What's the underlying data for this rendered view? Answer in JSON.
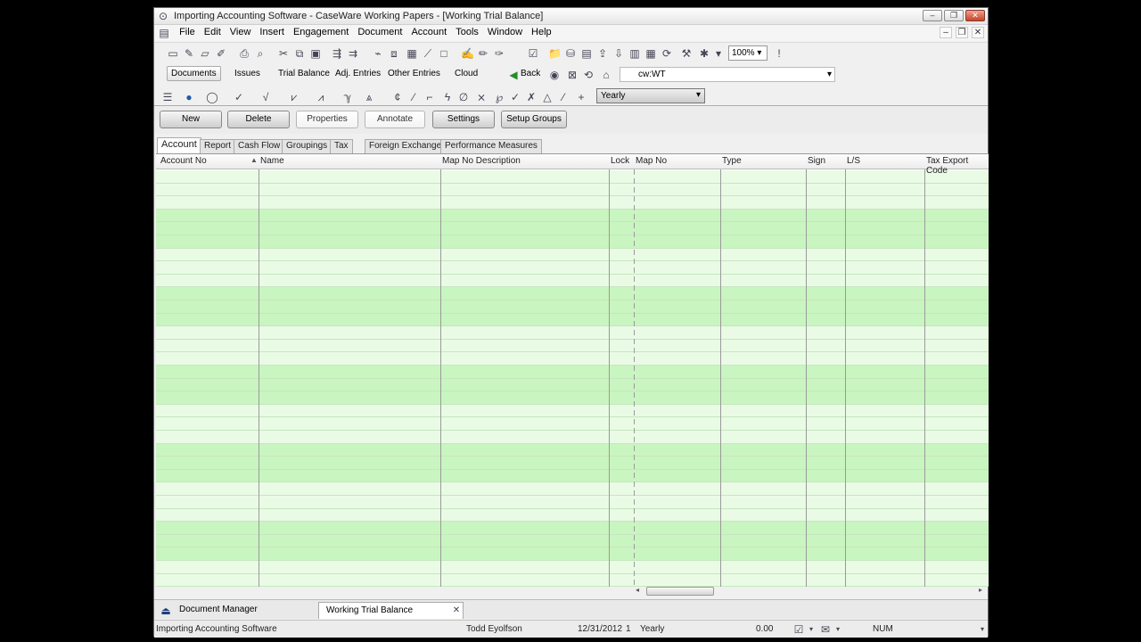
{
  "window": {
    "title": "Importing Accounting Software - CaseWare Working Papers - [Working Trial Balance]"
  },
  "menu": [
    "File",
    "Edit",
    "View",
    "Insert",
    "Engagement",
    "Document",
    "Account",
    "Tools",
    "Window",
    "Help"
  ],
  "toolbar": {
    "zoom": "100%"
  },
  "nav": {
    "items": [
      "Documents",
      "Issues",
      "Trial Balance",
      "Adj. Entries",
      "Other Entries",
      "Cloud"
    ],
    "back_label": "Back",
    "address": "cw:WT"
  },
  "period_select": "Yearly",
  "commands": [
    "New",
    "Delete",
    "Properties",
    "Annotate",
    "Settings",
    "Setup Groups"
  ],
  "tabs": [
    "Account",
    "Report",
    "Cash Flow",
    "Groupings",
    "Tax",
    "Foreign Exchange",
    "Performance Measures"
  ],
  "grid": {
    "columns": [
      "Account No",
      "Name",
      "Map No Description",
      "Lock",
      "Map No",
      "Type",
      "Sign",
      "L/S",
      "Tax Export Code"
    ]
  },
  "bottom_tabs": [
    "Document Manager",
    "Working Trial Balance"
  ],
  "status": {
    "file": "Importing Accounting Software",
    "user": "Todd Eyolfson",
    "date": "12/31/2012",
    "period": "1",
    "frequency": "Yearly",
    "amount": "0.00",
    "mode": "NUM"
  },
  "colors": {
    "grid_band": "#c9f5c0",
    "grid_light": "#e9fbe5"
  }
}
